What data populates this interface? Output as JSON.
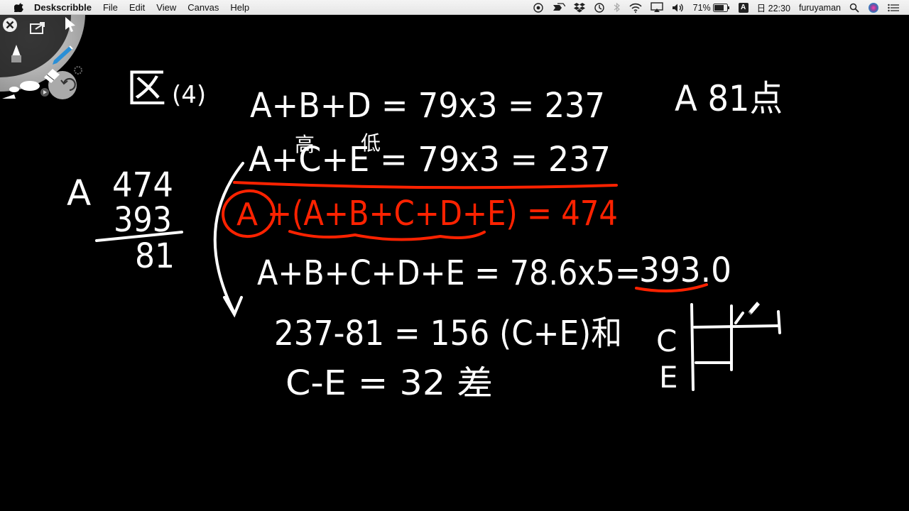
{
  "menubar": {
    "app_name": "Deskscribble",
    "menus": [
      "File",
      "Edit",
      "View",
      "Canvas",
      "Help"
    ],
    "status": {
      "battery_percent": "71%",
      "input_source": "A",
      "clock": "日 22:30",
      "user": "furuyaman"
    }
  },
  "palette": {
    "tools": [
      "close-icon",
      "share-icon",
      "marker-icon",
      "pen-icon",
      "eraser-icon",
      "brush-size-icon",
      "undo-icon",
      "play-icon",
      "settings-icon"
    ]
  },
  "board": {
    "problem_label": "区",
    "problem_number": "(4)",
    "eq1": "A+B+D = 79x3 = 237",
    "answer": "A 81点",
    "note_high": "高",
    "note_low": "低",
    "eq2": "A+C+E = 79x3 = 237",
    "eq3_circled": "A",
    "eq3_rest": "+(A+B+C+D+E) = 474",
    "eq4": "A+B+C+D+E = 78.6x5=",
    "eq4_result": "393.0",
    "calc_a": "A",
    "calc_top": "474",
    "calc_mid": "393",
    "calc_bottom": "81",
    "eq5": "237-81 = 156 (C+E)和",
    "eq6": "C-E = 32 差",
    "diagram_c": "C",
    "diagram_e": "E"
  },
  "colors": {
    "background": "#000000",
    "chalk": "#ffffff",
    "highlight": "#ff2200"
  }
}
